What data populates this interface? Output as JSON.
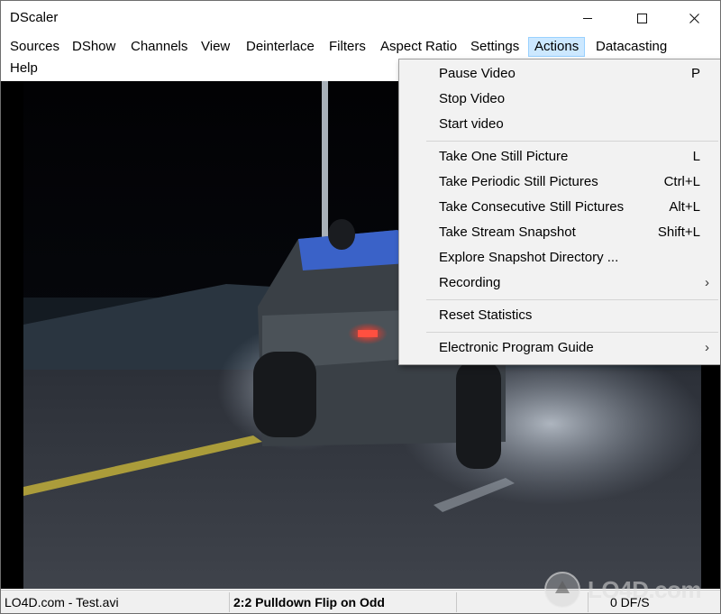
{
  "window": {
    "title": "DScaler"
  },
  "menubar": {
    "items": [
      "Sources",
      "DShow",
      "Channels",
      "View",
      "Deinterlace",
      "Filters",
      "Aspect Ratio",
      "Settings",
      "Actions",
      "Datacasting",
      "Help"
    ],
    "active": "Actions"
  },
  "actions_menu": {
    "items": [
      {
        "label": "Pause Video",
        "shortcut": "P"
      },
      {
        "label": "Stop Video",
        "shortcut": ""
      },
      {
        "label": "Start video",
        "shortcut": ""
      },
      {
        "label": "Take One Still Picture",
        "shortcut": "L"
      },
      {
        "label": "Take Periodic Still Pictures",
        "shortcut": "Ctrl+L"
      },
      {
        "label": "Take Consecutive Still Pictures",
        "shortcut": "Alt+L"
      },
      {
        "label": "Take Stream Snapshot",
        "shortcut": "Shift+L"
      },
      {
        "label": "Explore Snapshot Directory ...",
        "shortcut": ""
      },
      {
        "label": "Recording",
        "shortcut": "",
        "submenu": true
      },
      {
        "label": "Reset Statistics",
        "shortcut": ""
      },
      {
        "label": "Electronic Program Guide",
        "shortcut": "",
        "submenu": true
      }
    ]
  },
  "statusbar": {
    "source": "LO4D.com - Test.avi",
    "mode": "2:2 Pulldown Flip on Odd",
    "fps": "0 DF/S"
  },
  "watermark": {
    "text": "LO4D.com"
  },
  "icons": {
    "minimize": "minimize-icon",
    "maximize": "maximize-icon",
    "close": "close-icon",
    "submenu": "chevron-right-icon"
  }
}
